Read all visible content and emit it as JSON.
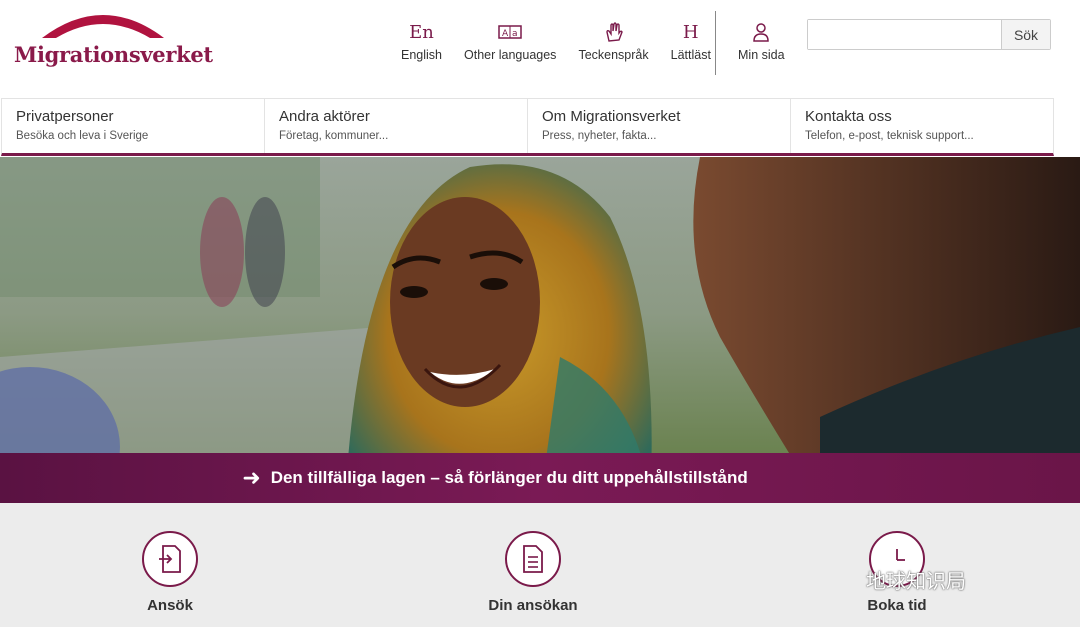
{
  "brand": {
    "name": "Migrationsverket",
    "color": "#8a1a4a"
  },
  "tools": [
    {
      "icon": "en-letters-icon",
      "glyph": "En",
      "label": "English"
    },
    {
      "icon": "language-translate-icon",
      "glyph": "",
      "label": "Other languages"
    },
    {
      "icon": "hand-sign-icon",
      "glyph": "",
      "label": "Teckenspråk"
    },
    {
      "icon": "h-letter-icon",
      "glyph": "H",
      "label": "Lättläst"
    }
  ],
  "mypage": {
    "icon": "user-icon",
    "label": "Min sida"
  },
  "search": {
    "value": "",
    "placeholder": "",
    "button": "Sök"
  },
  "nav": [
    {
      "title": "Privatpersoner",
      "sub": "Besöka och leva i Sverige"
    },
    {
      "title": "Andra aktörer",
      "sub": "Företag, kommuner..."
    },
    {
      "title": "Om Migrationsverket",
      "sub": "Press, nyheter, fakta..."
    },
    {
      "title": "Kontakta oss",
      "sub": "Telefon, e-post, teknisk support..."
    }
  ],
  "banner": {
    "icon": "arrow-right-icon",
    "text": "Den tillfälliga lagen – så förlänger du ditt uppehållstillstånd"
  },
  "tiles": [
    {
      "icon": "document-arrow-icon",
      "label": "Ansök"
    },
    {
      "icon": "document-lines-icon",
      "label": "Din ansökan"
    },
    {
      "icon": "clock-icon",
      "label": "Boka tid"
    }
  ],
  "watermark": "地球知识局"
}
